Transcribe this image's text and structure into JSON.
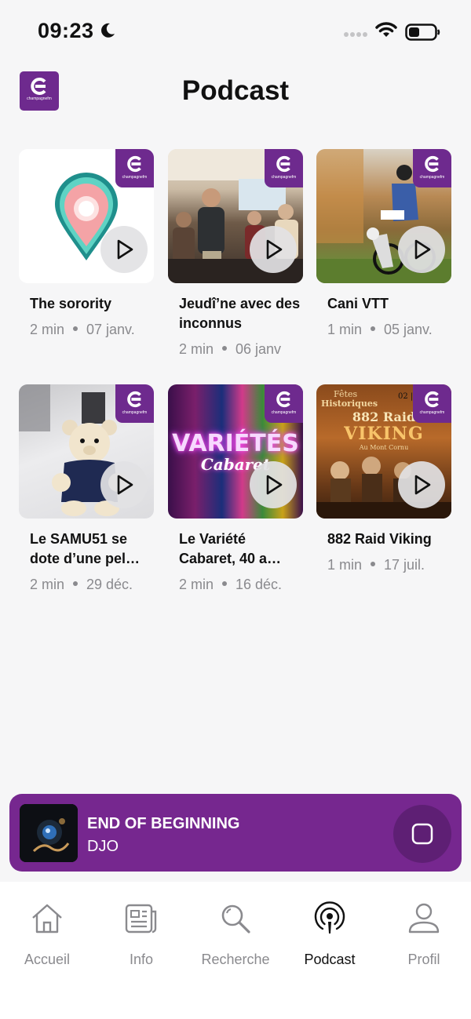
{
  "status_bar": {
    "time": "09:23"
  },
  "header": {
    "title": "Podcast",
    "logo_text": "champagnefm"
  },
  "badge_text": "champagnefm",
  "podcasts": [
    {
      "title": "The sorority",
      "duration": "2 min",
      "date": "07 janv."
    },
    {
      "title": "Jeudî’ne avec des inconnus",
      "duration": "2 min",
      "date": "06 janv"
    },
    {
      "title": "Cani VTT",
      "duration": "1 min",
      "date": "05 janv."
    },
    {
      "title": "Le SAMU51 se dote d’une pel…",
      "duration": "2 min",
      "date": "29 déc."
    },
    {
      "title": "Le Variété Cabaret, 40 a…",
      "duration": "2 min",
      "date": "16 déc."
    },
    {
      "title": "882 Raid Viking",
      "duration": "1 min",
      "date": "17 juil."
    }
  ],
  "thumb_text": {
    "variete_line1": "VARIÉTÉS",
    "variete_line2": "Cabaret",
    "raid_line1": "Fêtes",
    "raid_line2": "Historiques",
    "raid_date": "02 | 03",
    "raid_line3": "882 Raid",
    "raid_line4": "VIKING",
    "raid_line5": "Au Mont Cornu"
  },
  "player": {
    "title": "END OF BEGINNING",
    "artist": "DJO"
  },
  "tabs": [
    {
      "label": "Accueil",
      "icon": "home-icon"
    },
    {
      "label": "Info",
      "icon": "newspaper-icon"
    },
    {
      "label": "Recherche",
      "icon": "search-icon"
    },
    {
      "label": "Podcast",
      "icon": "podcast-icon"
    },
    {
      "label": "Profil",
      "icon": "person-icon"
    }
  ],
  "colors": {
    "brand": "#6e2a8e",
    "player_bg": "#76278f",
    "muted": "#8a8a8e"
  }
}
